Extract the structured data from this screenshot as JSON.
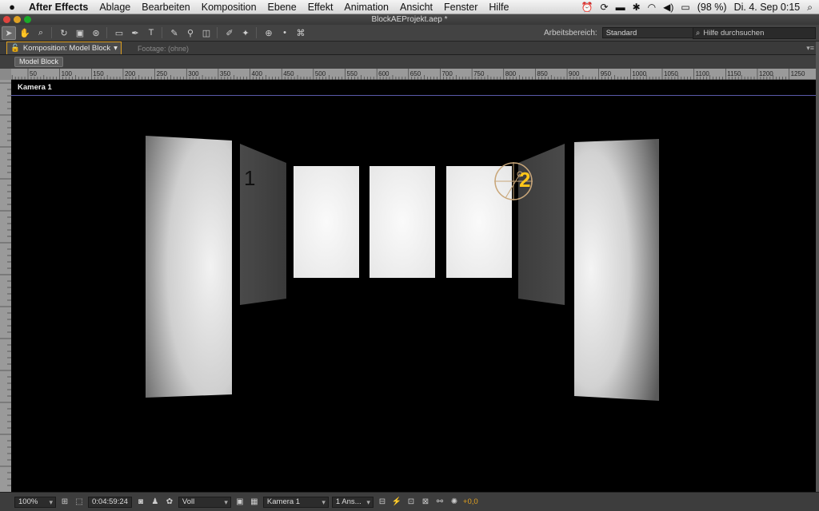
{
  "menubar": {
    "app_name": "After Effects",
    "items": [
      "Ablage",
      "Bearbeiten",
      "Komposition",
      "Ebene",
      "Effekt",
      "Animation",
      "Ansicht",
      "Fenster",
      "Hilfe"
    ],
    "battery": "(98 %)",
    "clock": "Di. 4. Sep  0:15"
  },
  "window": {
    "title": "BlockAEProjekt.aep *"
  },
  "toolbar": {
    "workspace_label": "Arbeitsbereich:",
    "workspace_value": "Standard",
    "help_placeholder": "Hilfe durchsuchen"
  },
  "panels": {
    "active_tab": "Komposition: Model Block",
    "footage_tab": "Footage: (ohne)",
    "comp_chip": "Model Block"
  },
  "ruler": {
    "ticks": [
      "50",
      "100",
      "150",
      "200",
      "250",
      "300",
      "350",
      "400",
      "450",
      "500",
      "550",
      "600",
      "650",
      "700",
      "750",
      "800",
      "850",
      "900",
      "950",
      "1000",
      "1050",
      "1100",
      "1150",
      "1200",
      "1250"
    ]
  },
  "viewer": {
    "camera_label": "Kamera 1",
    "marker_1": "1",
    "marker_2": "2"
  },
  "bottombar": {
    "zoom": "100%",
    "timecode": "0:04:59:24",
    "resolution": "Voll",
    "camera": "Kamera 1",
    "views": "1 Ans...",
    "exposure": "+0,0"
  },
  "colors": {
    "accent": "#e0a020",
    "viewer_bg": "#000000",
    "marker2": "#ffc61a"
  }
}
